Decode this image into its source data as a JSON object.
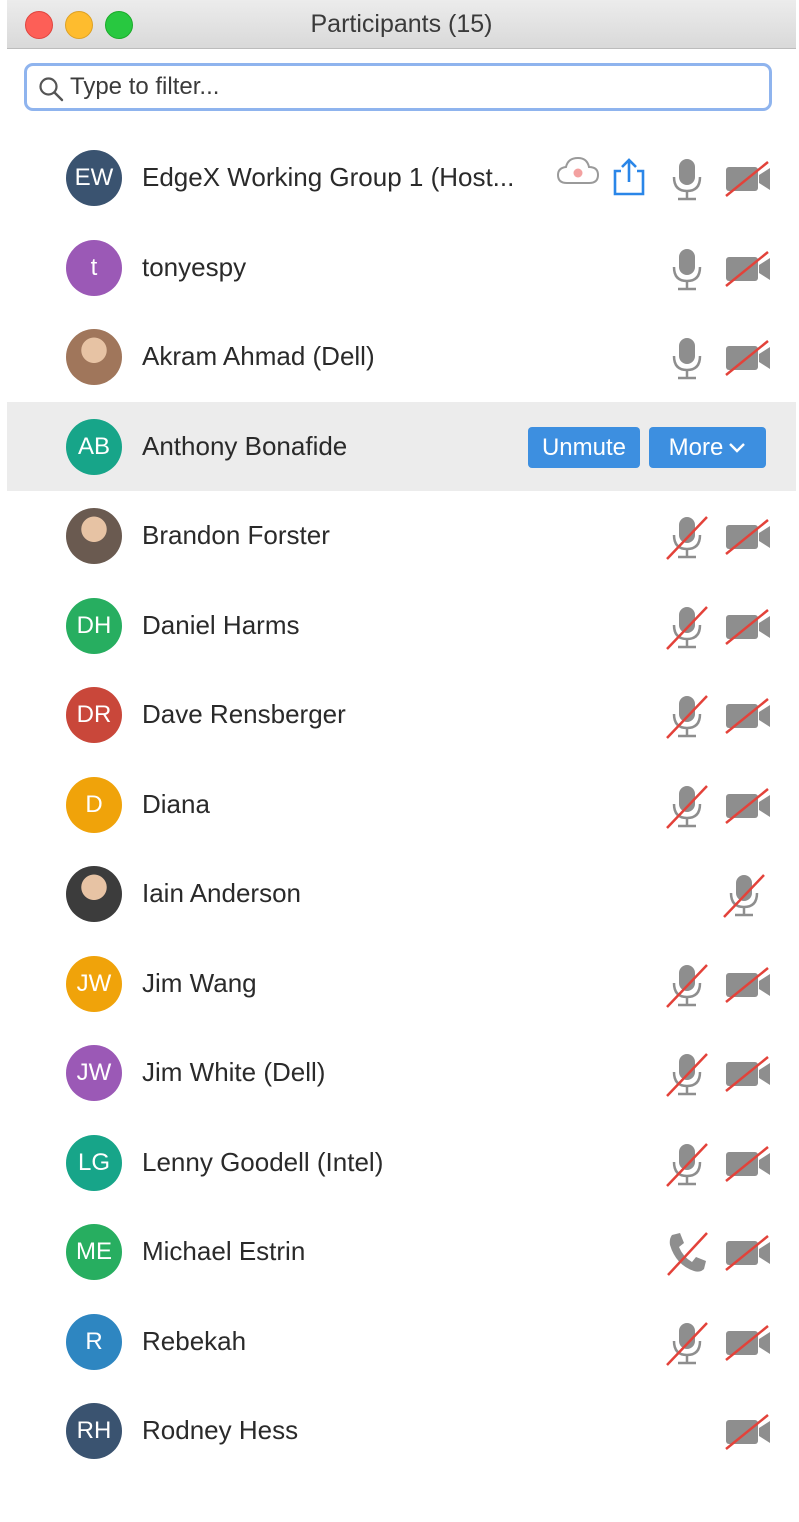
{
  "window": {
    "title": "Participants (15)"
  },
  "filter": {
    "placeholder": "Type to filter..."
  },
  "colors": {
    "accent": "#3d8fe0",
    "muted_slash": "#e3423a",
    "icon_gray": "#8e8e8e"
  },
  "participants": [
    {
      "initials": "EW",
      "name": "EdgeX Working Group 1 (Host...",
      "avatar_color": "#3a5370",
      "mic": "on",
      "video": "off",
      "host_icons": true
    },
    {
      "initials": "t",
      "name": "tonyespy",
      "avatar_color": "#9b59b6",
      "mic": "on",
      "video": "off"
    },
    {
      "initials": "",
      "name": "Akram Ahmad (Dell)",
      "avatar_color": "#a0765b",
      "photo": true,
      "mic": "on",
      "video": "off"
    },
    {
      "initials": "AB",
      "name": "Anthony Bonafide",
      "avatar_color": "#17a589",
      "hovered": true
    },
    {
      "initials": "",
      "name": "Brandon Forster",
      "avatar_color": "#6a5a50",
      "photo": true,
      "mic": "muted",
      "video": "off"
    },
    {
      "initials": "DH",
      "name": "Daniel Harms",
      "avatar_color": "#27ae60",
      "mic": "muted",
      "video": "off"
    },
    {
      "initials": "DR",
      "name": "Dave Rensberger",
      "avatar_color": "#c9473a",
      "mic": "muted",
      "video": "off"
    },
    {
      "initials": "D",
      "name": "Diana",
      "avatar_color": "#f0a30a",
      "mic": "muted",
      "video": "off"
    },
    {
      "initials": "",
      "name": "Iain Anderson",
      "avatar_color": "#3c3c3c",
      "photo": true,
      "mic": "muted",
      "video": "none"
    },
    {
      "initials": "JW",
      "name": "Jim Wang",
      "avatar_color": "#f0a30a",
      "mic": "muted",
      "video": "off"
    },
    {
      "initials": "JW",
      "name": "Jim White (Dell)",
      "avatar_color": "#9b59b6",
      "mic": "muted",
      "video": "off"
    },
    {
      "initials": "LG",
      "name": "Lenny Goodell (Intel)",
      "avatar_color": "#17a589",
      "mic": "muted",
      "video": "off"
    },
    {
      "initials": "ME",
      "name": "Michael Estrin",
      "avatar_color": "#27ae60",
      "mic": "phone-muted",
      "video": "off"
    },
    {
      "initials": "R",
      "name": "Rebekah",
      "avatar_color": "#2e86c1",
      "mic": "muted",
      "video": "off"
    },
    {
      "initials": "RH",
      "name": "Rodney Hess",
      "avatar_color": "#3a5370",
      "mic": "none",
      "video": "off"
    }
  ],
  "hover_actions": {
    "unmute_label": "Unmute",
    "more_label": "More"
  }
}
